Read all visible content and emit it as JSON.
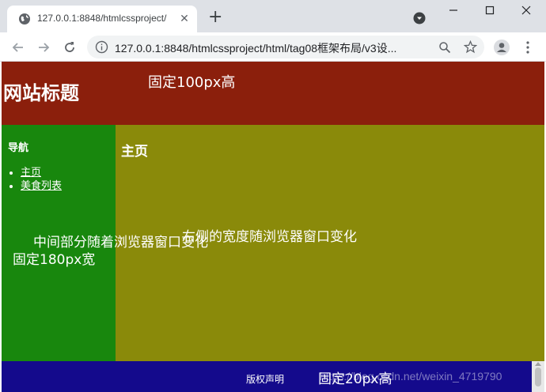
{
  "browser": {
    "tab_title": "127.0.0.1:8848/htmlcssproject/",
    "tab_close_glyph": "✕",
    "new_tab_glyph": "+",
    "url": "127.0.0.1:8848/htmlcssproject/html/tag08框架布局/v3设...",
    "icons": [
      "globe-icon",
      "close-icon",
      "plus-icon",
      "tab-search-icon",
      "minimize-icon",
      "maximize-icon",
      "window-close-icon",
      "back-arrow-icon",
      "forward-arrow-icon",
      "reload-icon",
      "info-icon",
      "zoom-icon",
      "star-icon",
      "profile-icon",
      "menu-dots-icon"
    ]
  },
  "page": {
    "header": {
      "title": "网站标题",
      "note": "固定100px高",
      "color": "#8b1f0c"
    },
    "nav": {
      "heading": "导航",
      "items": [
        {
          "label": "主页"
        },
        {
          "label": "美食列表"
        }
      ],
      "note": "固定180px宽",
      "color": "#18870d"
    },
    "main": {
      "heading": "主页",
      "note": "右侧的宽度随浏览器窗口变化",
      "color": "#8a8a0a"
    },
    "middle_note": "中间部分随着浏览器窗口变化",
    "footer": {
      "copyright": "版权声明",
      "note": "固定20px高",
      "watermark": "https://blog.csdn.net/weixin_4719790",
      "color": "#140a8c"
    }
  }
}
